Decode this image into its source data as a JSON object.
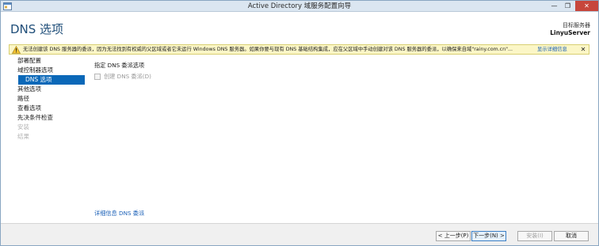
{
  "window": {
    "title": "Active Directory 域服务配置向导",
    "min_glyph": "—",
    "max_glyph": "❐",
    "close_glyph": "✕",
    "app_icon": "wizard-window-icon"
  },
  "header": {
    "page_title": "DNS 选项",
    "target_label": "目标服务器",
    "target_name": "LinyuServer"
  },
  "warning": {
    "icon": "warning-triangle-icon",
    "text": "无法创建该 DNS 服务器的委派，因为无法找到有权威的父区域或者它未运行 Windows DNS 服务器。如果你要与现有 DNS 基础结构集成，应在父区域中手动创建对该 DNS 服务器的委派，以确保来自域\"rainy.com.cn\"...",
    "link": "显示详细信息",
    "close_glyph": "✕",
    "color": "#fbf6c6"
  },
  "nav": {
    "items": [
      {
        "label": "部署配置",
        "state": "normal"
      },
      {
        "label": "域控制器选项",
        "state": "normal"
      },
      {
        "label": "DNS 选项",
        "state": "active"
      },
      {
        "label": "其他选项",
        "state": "normal"
      },
      {
        "label": "路径",
        "state": "normal"
      },
      {
        "label": "查看选项",
        "state": "normal"
      },
      {
        "label": "先决条件检查",
        "state": "normal"
      },
      {
        "label": "安装",
        "state": "disabled"
      },
      {
        "label": "结果",
        "state": "disabled"
      }
    ],
    "active_color": "#0b68b8"
  },
  "content": {
    "heading": "指定 DNS 委派选项",
    "checkbox_label": "创建 DNS 委派(D)",
    "checkbox_checked": false,
    "more_link": "详细信息 DNS 委派"
  },
  "footer": {
    "prev": "< 上一步(P)",
    "next": "下一步(N) >",
    "install": "安装(I)",
    "cancel": "取消"
  }
}
